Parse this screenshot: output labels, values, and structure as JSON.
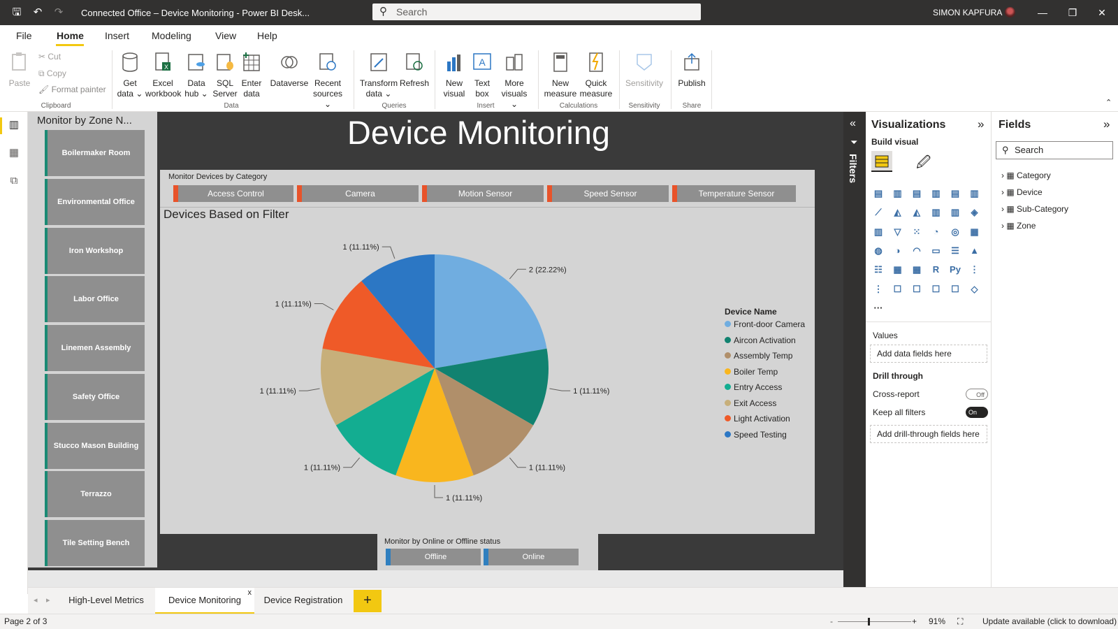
{
  "window": {
    "title": "Connected Office – Device Monitoring - Power BI Desk...",
    "search_placeholder": "Search",
    "user": "SIMON KAPFURA"
  },
  "menu": [
    "File",
    "Home",
    "Insert",
    "Modeling",
    "View",
    "Help"
  ],
  "ribbon": {
    "clipboard": {
      "paste": "Paste",
      "cut": "Cut",
      "copy": "Copy",
      "format_painter": "Format painter",
      "group": "Clipboard"
    },
    "data": {
      "get_data": "Get data ⌄",
      "excel": "Excel workbook",
      "data_hub": "Data hub ⌄",
      "sql": "SQL Server",
      "enter": "Enter data",
      "dataverse": "Dataverse",
      "recent": "Recent sources ⌄",
      "group": "Data"
    },
    "queries": {
      "transform": "Transform data ⌄",
      "refresh": "Refresh",
      "group": "Queries"
    },
    "insert": {
      "new_visual": "New visual",
      "text_box": "Text box",
      "more_visuals": "More visuals ⌄",
      "group": "Insert"
    },
    "calculations": {
      "new_measure": "New measure",
      "quick_measure": "Quick measure",
      "group": "Calculations"
    },
    "sensitivity": {
      "label": "Sensitivity",
      "group": "Sensitivity"
    },
    "share": {
      "publish": "Publish",
      "group": "Share"
    }
  },
  "report": {
    "title": "Device Monitoring",
    "zone_slicer": {
      "title": "Monitor by Zone N...",
      "items": [
        "Boilermaker Room",
        "Environmental Office",
        "Iron Workshop",
        "Labor Office",
        "Linemen Assembly",
        "Safety Office",
        "Stucco Mason Building",
        "Terrazzo",
        "Tile Setting Bench"
      ]
    },
    "category_slicer": {
      "title": "Monitor Devices by Category",
      "items": [
        "Access Control",
        "Camera",
        "Motion Sensor",
        "Speed Sensor",
        "Temperature Sensor"
      ]
    },
    "pie_title": "Devices Based on Filter",
    "legend_title": "Device Name",
    "status_slicer": {
      "title": "Monitor by Online or Offline status",
      "items": [
        "Offline",
        "Online"
      ]
    }
  },
  "chart_data": {
    "type": "pie",
    "title": "Devices Based on Filter",
    "legend_title": "Device Name",
    "categories": [
      "Front-door Camera",
      "Aircon Activation",
      "Assembly Temp",
      "Boiler Temp",
      "Entry Access",
      "Exit Access",
      "Light Activation",
      "Speed Testing"
    ],
    "values": [
      2,
      1,
      1,
      1,
      1,
      1,
      1,
      1
    ],
    "labels": [
      "2 (22.22%)",
      "1 (11.11%)",
      "1 (11.11%)",
      "1 (11.11%)",
      "1 (11.11%)",
      "1 (11.11%)",
      "1 (11.11%)",
      "1 (11.11%)"
    ],
    "colors": [
      "#70ade0",
      "#118270",
      "#b08f6a",
      "#f9b61e",
      "#13ad91",
      "#c7af7a",
      "#ef5a28",
      "#2c77c4"
    ]
  },
  "filters_label": "Filters",
  "visualizations": {
    "title": "Visualizations",
    "build": "Build visual",
    "values": "Values",
    "add_data": "Add data fields here",
    "drill": "Drill through",
    "cross": "Cross-report",
    "cross_state": "Off",
    "keep": "Keep all filters",
    "keep_state": "On",
    "add_drill": "Add drill-through fields here",
    "r": "R",
    "py": "Py",
    "more": "···"
  },
  "fields": {
    "title": "Fields",
    "search": "Search",
    "tables": [
      "Category",
      "Device",
      "Sub-Category",
      "Zone"
    ]
  },
  "tabs": [
    "High-Level Metrics",
    "Device Monitoring",
    "Device Registration"
  ],
  "tab_close": "x",
  "add_tab": "+",
  "status": {
    "page": "Page 2 of 3",
    "zoom": "91%",
    "update": "Update available (click to download)",
    "minus": "-",
    "plus": "+"
  }
}
